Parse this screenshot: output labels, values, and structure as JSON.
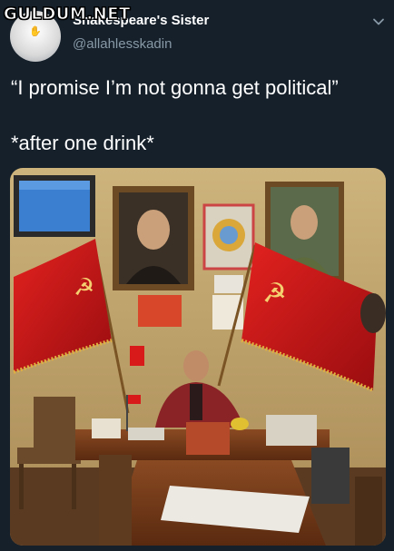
{
  "watermark": "GULDUM.NET",
  "tweet": {
    "display_name": "Shakespeare's Sister",
    "handle": "@allahlesskadin",
    "text_line1": "“I promise I’m not gonna get political”",
    "text_line2": "*after one drink*"
  },
  "icons": {
    "menu": "chevron-down-icon",
    "avatar_mark": "hand-icon",
    "photo_flag_emblem": "hammer-sickle-icon"
  },
  "colors": {
    "background": "#15202b",
    "text_primary": "#ffffff",
    "text_secondary": "#8899a6",
    "flag_red": "#d0141a",
    "wall": "#c8b07a"
  }
}
